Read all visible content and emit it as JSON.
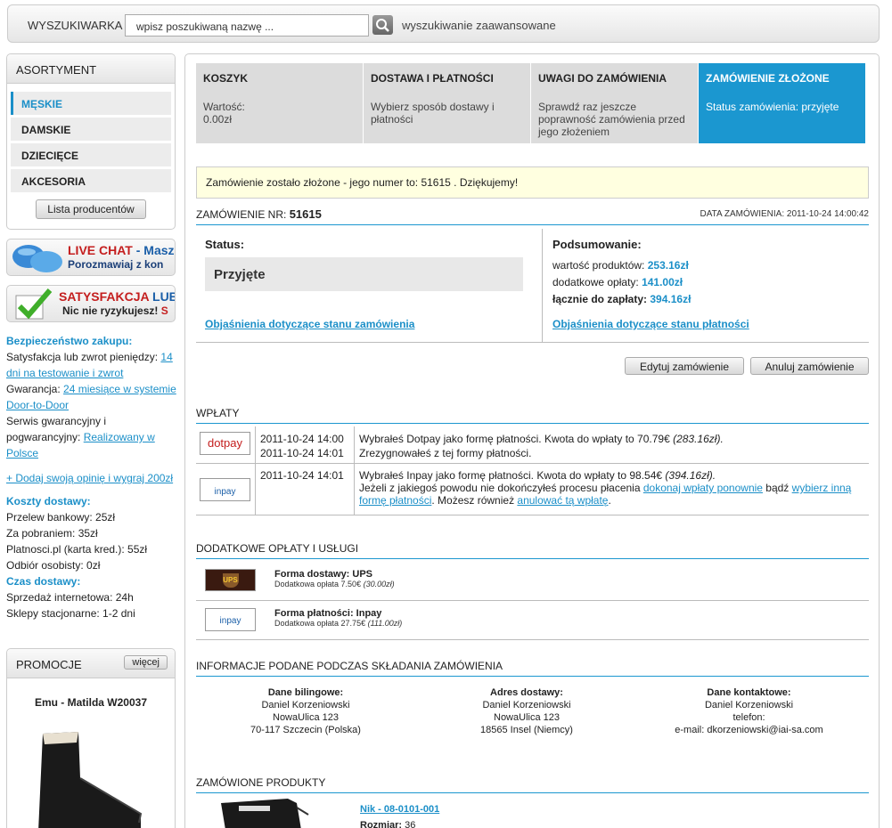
{
  "search": {
    "label": "WYSZUKIWARKA",
    "placeholder": "wpisz poszukiwaną nazwę ...",
    "advanced": "wyszukiwanie zaawansowane"
  },
  "sidebar": {
    "header": "ASORTYMENT",
    "categories": [
      "MĘSKIE",
      "DAMSKIE",
      "DZIECIĘCE",
      "AKCESORIA"
    ],
    "producers_button": "Lista producentów",
    "livechat": {
      "title_red": "LIVE CHAT",
      "title_rest": " - Masz",
      "sub": "Porozmawiaj z kon"
    },
    "satisfaction": {
      "title_red": "SATYSFAKCJA",
      "title_rest": " LUB",
      "sub": "Nic nie ryzykujesz!",
      "sub_red": " S"
    },
    "safety_header": "Bezpieczeństwo zakupu:",
    "safety_1_text": "Satysfakcja lub zwrot pieniędzy: ",
    "safety_1_link": "14 dni na testowanie i zwrot",
    "safety_2_text": "Gwarancja: ",
    "safety_2_link": "24 miesiące w systemie Door-to-Door",
    "safety_3_text": "Serwis gwarancyjny i pogwarancyjny: ",
    "safety_3_link": "Realizowany w Polsce",
    "opinion_link": "+ Dodaj swoją opinię i wygraj 200zł",
    "shipping_header": "Koszty dostawy:",
    "shipping": [
      "Przelew bankowy: 25zł",
      "Za pobraniem: 35zł",
      "Platnosci.pl (karta kred.): 55zł",
      "Odbiór osobisty: 0zł"
    ],
    "time_header": "Czas dostawy:",
    "time": [
      "Sprzedaż internetowa: 24h",
      "Sklepy stacjonarne: 1-2 dni"
    ],
    "promo_header": "PROMOCJE",
    "promo_more": "więcej",
    "promo_product": "Emu - Matilda W20037"
  },
  "steps": [
    {
      "title": "KOSZYK",
      "text": "Wartość:\n0.00zł"
    },
    {
      "title": "DOSTAWA I PŁATNOŚCI",
      "text": "Wybierz sposób dostawy i płatności"
    },
    {
      "title": "UWAGI DO ZAMÓWIENIA",
      "text": "Sprawdź raz jeszcze poprawność zamówienia przed jego złożeniem"
    },
    {
      "title": "ZAMÓWIENIE ZŁOŻONE",
      "text": "Status zamówienia: przyjęte"
    }
  ],
  "notice": "Zamówienie zostało złożone - jego numer to: 51615 . Dziękujemy!",
  "order": {
    "label": "ZAMÓWIENIE NR:",
    "number": "51615",
    "date_label": "DATA ZAMÓWIENIA: 2011-10-24 14:00:42",
    "status_label": "Status:",
    "status_value": "Przyjęte",
    "status_link": "Objaśnienia dotyczące stanu zamówienia",
    "summary_label": "Podsumowanie:",
    "products_label": "wartość produktów:",
    "products_value": "253.16zł",
    "extra_label": "dodatkowe opłaty:",
    "extra_value": "141.00zł",
    "total_label": "łącznie do zapłaty:",
    "total_value": "394.16zł",
    "payment_link": "Objaśnienia dotyczące stanu płatności",
    "edit_button": "Edytuj zamówienie",
    "cancel_button": "Anuluj zamówienie"
  },
  "payments": {
    "title": "WPŁATY",
    "dotpay_logo": "dotpay",
    "inpay_logo": "inpay",
    "p1_time1": "2011-10-24 14:00",
    "p1_text1": "Wybrałeś Dotpay jako formę płatności. Kwota do wpłaty to 70.79€ ",
    "p1_text1_it": "(283.16zł).",
    "p1_time2": "2011-10-24 14:01",
    "p1_text2": "Zrezygnowałeś z tej formy płatności.",
    "p2_time": "2011-10-24 14:01",
    "p2_text": "Wybrałeś Inpay jako formę płatności. Kwota do wpłaty to 98.54€ ",
    "p2_text_it": "(394.16zł).",
    "p2_line2a": "Jeżeli z jakiegoś powodu nie dokończyłeś procesu płacenia ",
    "p2_link1": "dokonaj wpłaty ponownie",
    "p2_line2b": " bądź ",
    "p2_link2": "wybierz inną formę płatności",
    "p2_line2c": ". Możesz również ",
    "p2_link3": "anulować tą wpłatę",
    "p2_line2d": "."
  },
  "extras": {
    "title": "DODATKOWE OPŁATY I USŁUGI",
    "e1_logo": "UPS",
    "e1_title": "Forma dostawy: UPS",
    "e1_sub": "Dodatkowa opłata 7.50€ ",
    "e1_sub_it": "(30.00zł)",
    "e2_logo": "inpay",
    "e2_title": "Forma płatności: Inpay",
    "e2_sub": "Dodatkowa opłata 27.75€ ",
    "e2_sub_it": "(111.00zł)"
  },
  "info": {
    "title": "INFORMACJE PODANE PODCZAS SKŁADANIA ZAMÓWIENIA",
    "billing_h": "Dane bilingowe:",
    "billing": [
      "Daniel Korzeniowski",
      "NowaUlica 123",
      "70-117 Szczecin (Polska)"
    ],
    "delivery_h": "Adres dostawy:",
    "delivery": [
      "Daniel Korzeniowski",
      "NowaUlica 123",
      "18565 Insel (Niemcy)"
    ],
    "contact_h": "Dane kontaktowe:",
    "contact": [
      "Daniel Korzeniowski",
      "telefon:",
      "e-mail: dkorzeniowski@iai-sa.com"
    ]
  },
  "products": {
    "title": "ZAMÓWIONE PRODUKTY",
    "p1_name": "Nik - 08-0101-001",
    "p1_size_label": "Rozmiar:",
    "p1_size": "36"
  }
}
